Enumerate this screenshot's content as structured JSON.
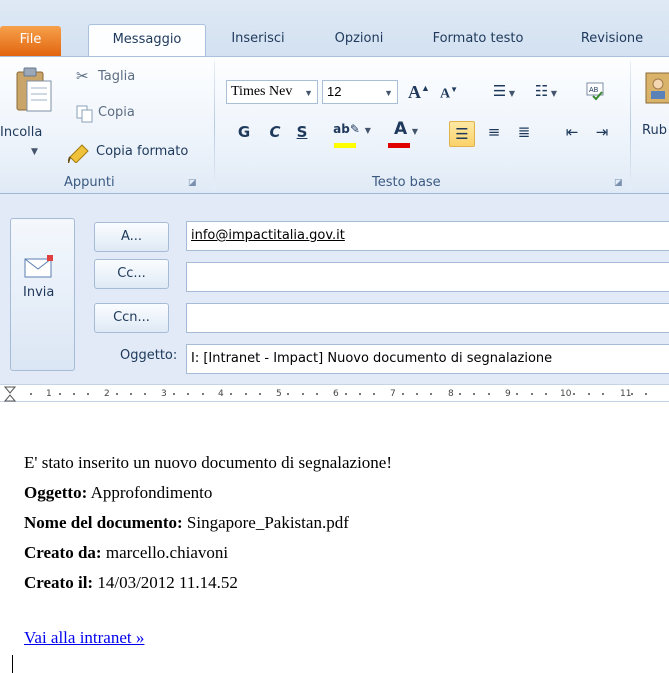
{
  "tabs": {
    "file": "File",
    "message": "Messaggio",
    "insert": "Inserisci",
    "options": "Opzioni",
    "format_text": "Formato testo",
    "review": "Revisione"
  },
  "clipboard": {
    "paste": "Incolla",
    "cut": "Taglia",
    "copy": "Copia",
    "format_painter": "Copia formato",
    "group_label": "Appunti"
  },
  "basic_text": {
    "font_name": "Times Nev",
    "font_size": "12",
    "bold": "G",
    "italic": "C",
    "underline": "S",
    "group_label": "Testo base"
  },
  "names": {
    "address_book_partial": "Rub"
  },
  "compose": {
    "send": "Invia",
    "to_button": "A...",
    "cc_button": "Cc...",
    "bcc_button": "Ccn...",
    "subject_label": "Oggetto:",
    "to_value": "info@impactitalia.gov.it",
    "cc_value": "",
    "bcc_value": "",
    "subject_value": "I: [Intranet - Impact] Nuovo documento di segnalazione"
  },
  "ruler": {
    "marks": [
      "1",
      "2",
      "3",
      "4",
      "5",
      "6",
      "7",
      "8",
      "9",
      "10",
      "11"
    ]
  },
  "body": {
    "intro": "E' stato inserito un nuovo documento di segnalazione!",
    "subject_label": "Oggetto:",
    "subject_value": "Approfondimento",
    "docname_label": "Nome del documento:",
    "docname_value": "Singapore_Pakistan.pdf",
    "author_label": "Creato da:",
    "author_value": "marcello.chiavoni",
    "created_label": "Creato il:",
    "created_value": "14/03/2012 11.14.52",
    "link": "Vai alla intranet »"
  },
  "colors": {
    "file_tab": "#e2650f",
    "ribbon": "#e0eaf6",
    "header_bg": "#e1eaf6",
    "link": "#0000ee",
    "highlight_yellow": "#ffff00",
    "font_color_red": "#e00000"
  }
}
